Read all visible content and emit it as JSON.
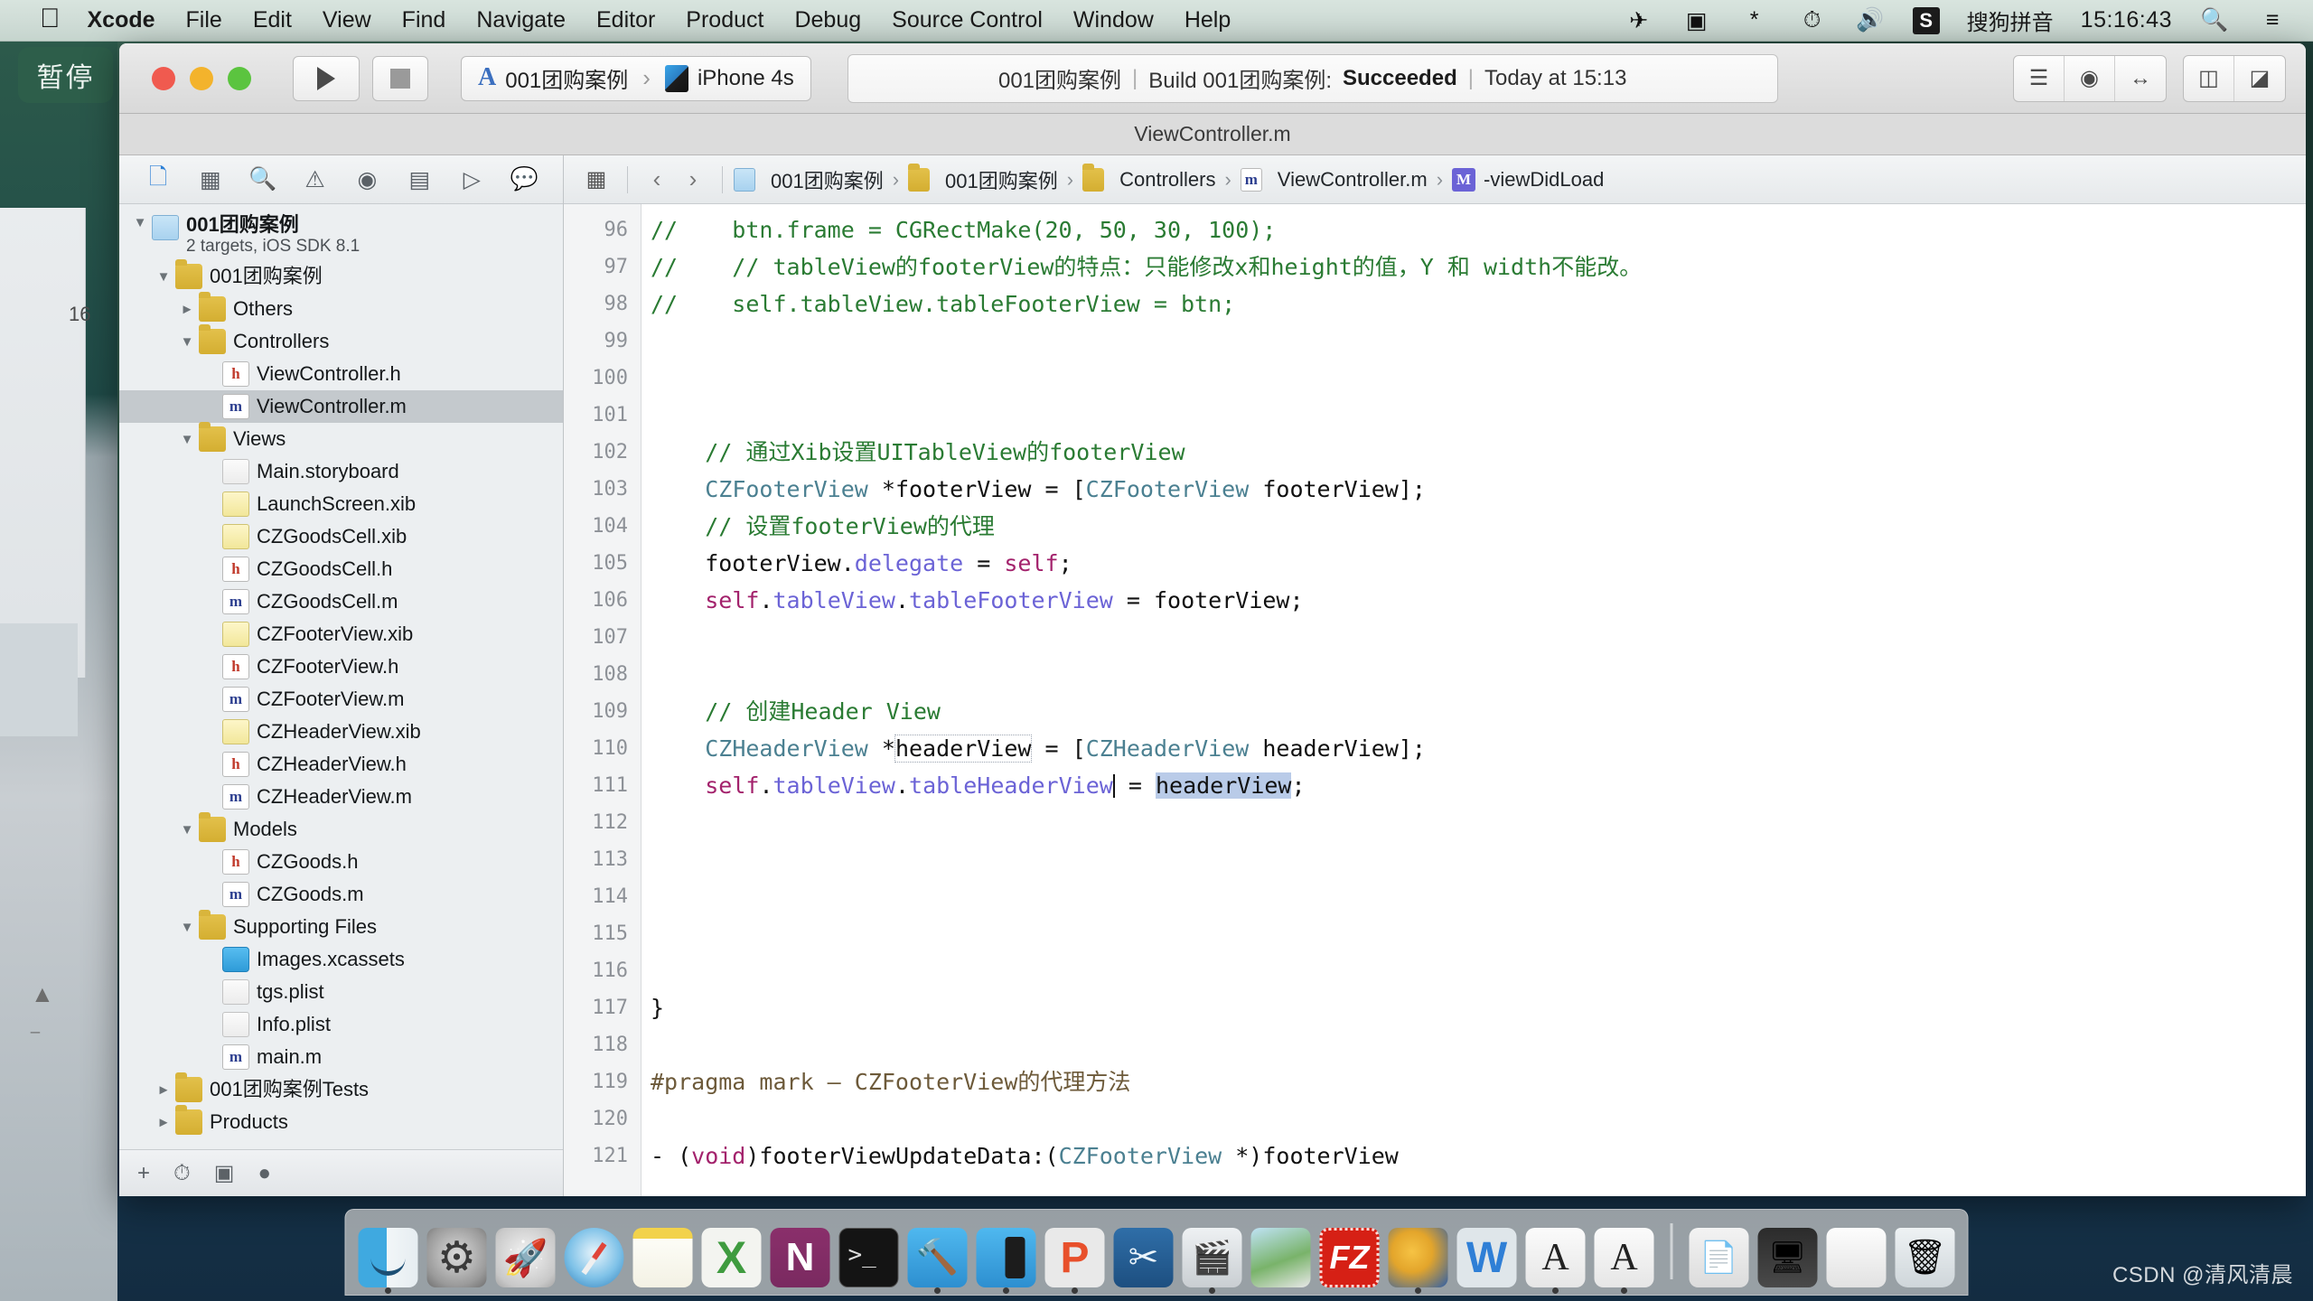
{
  "menubar": {
    "apple_icon": "apple-logo-icon",
    "items": [
      {
        "label": "Xcode",
        "bold": true
      },
      {
        "label": "File",
        "bold": false
      },
      {
        "label": "Edit",
        "bold": false
      },
      {
        "label": "View",
        "bold": false
      },
      {
        "label": "Find",
        "bold": false
      },
      {
        "label": "Navigate",
        "bold": false
      },
      {
        "label": "Editor",
        "bold": false
      },
      {
        "label": "Product",
        "bold": false
      },
      {
        "label": "Debug",
        "bold": false
      },
      {
        "label": "Source Control",
        "bold": false
      },
      {
        "label": "Window",
        "bold": false
      },
      {
        "label": "Help",
        "bold": false
      }
    ],
    "status": {
      "airplane_icon": "airplane-icon",
      "screenrecord_icon": "video-camera-icon",
      "bluetooth_icon": "bluetooth-icon",
      "timemachine_icon": "time-machine-clock-icon",
      "volume_icon": "speaker-volume-icon",
      "sogou_badge": "S",
      "ime_label": "搜狗拼音",
      "clock": "15:16:43",
      "search_icon": "spotlight-search-icon",
      "notification_icon": "notification-center-icon"
    }
  },
  "overlay": {
    "pause_badge": "暂停",
    "strip_number": "16",
    "eject_icon": "eject-icon"
  },
  "xcode": {
    "toolbar": {
      "run_icon": "play-run-icon",
      "stop_icon": "stop-square-icon",
      "scheme_app_icon": "xcode-scheme-icon",
      "scheme_name": "001团购案例",
      "scheme_separator": "›",
      "device_icon": "iphone-device-icon",
      "device_name": "iPhone 4s",
      "activity": {
        "project": "001团购案例",
        "sep1": "|",
        "build_prefix": "Build 001团购案例:",
        "build_status": "Succeeded",
        "sep2": "|",
        "build_time": "Today at 15:13"
      },
      "right_icons": [
        "standard-editor-icon",
        "assistant-editor-icon",
        "version-editor-icon",
        "hide-navigator-icon",
        "hide-utilities-icon"
      ]
    },
    "tabbar": {
      "active_tab": "ViewController.m"
    },
    "navigator": {
      "toolbar_icons": [
        "project-navigator-icon",
        "symbol-navigator-icon",
        "find-navigator-icon",
        "issue-navigator-icon",
        "test-navigator-icon",
        "debug-navigator-icon",
        "breakpoint-navigator-icon",
        "report-navigator-icon"
      ],
      "footer_icons": [
        "add-icon",
        "recent-filter-icon",
        "source-control-filter-icon",
        "filter-field-icon"
      ],
      "tree": [
        {
          "label": "001团购案例",
          "sub": "2 targets, iOS SDK 8.1",
          "icon": "proj",
          "indent": 0,
          "twisty": "down",
          "bold": true,
          "selected": false
        },
        {
          "label": "001团购案例",
          "sub": "",
          "icon": "folder",
          "indent": 1,
          "twisty": "down",
          "bold": false,
          "selected": false
        },
        {
          "label": "Others",
          "sub": "",
          "icon": "folder",
          "indent": 2,
          "twisty": "right",
          "bold": false,
          "selected": false
        },
        {
          "label": "Controllers",
          "sub": "",
          "icon": "folder",
          "indent": 2,
          "twisty": "down",
          "bold": false,
          "selected": false
        },
        {
          "label": "ViewController.h",
          "sub": "",
          "icon": "h",
          "indent": 3,
          "twisty": "none",
          "bold": false,
          "selected": false
        },
        {
          "label": "ViewController.m",
          "sub": "",
          "icon": "m",
          "indent": 3,
          "twisty": "none",
          "bold": false,
          "selected": true
        },
        {
          "label": "Views",
          "sub": "",
          "icon": "folder",
          "indent": 2,
          "twisty": "down",
          "bold": false,
          "selected": false
        },
        {
          "label": "Main.storyboard",
          "sub": "",
          "icon": "sb",
          "indent": 3,
          "twisty": "none",
          "bold": false,
          "selected": false
        },
        {
          "label": "LaunchScreen.xib",
          "sub": "",
          "icon": "xib",
          "indent": 3,
          "twisty": "none",
          "bold": false,
          "selected": false
        },
        {
          "label": "CZGoodsCell.xib",
          "sub": "",
          "icon": "xib",
          "indent": 3,
          "twisty": "none",
          "bold": false,
          "selected": false
        },
        {
          "label": "CZGoodsCell.h",
          "sub": "",
          "icon": "h",
          "indent": 3,
          "twisty": "none",
          "bold": false,
          "selected": false
        },
        {
          "label": "CZGoodsCell.m",
          "sub": "",
          "icon": "m",
          "indent": 3,
          "twisty": "none",
          "bold": false,
          "selected": false
        },
        {
          "label": "CZFooterView.xib",
          "sub": "",
          "icon": "xib",
          "indent": 3,
          "twisty": "none",
          "bold": false,
          "selected": false
        },
        {
          "label": "CZFooterView.h",
          "sub": "",
          "icon": "h",
          "indent": 3,
          "twisty": "none",
          "bold": false,
          "selected": false
        },
        {
          "label": "CZFooterView.m",
          "sub": "",
          "icon": "m",
          "indent": 3,
          "twisty": "none",
          "bold": false,
          "selected": false
        },
        {
          "label": "CZHeaderView.xib",
          "sub": "",
          "icon": "xib",
          "indent": 3,
          "twisty": "none",
          "bold": false,
          "selected": false
        },
        {
          "label": "CZHeaderView.h",
          "sub": "",
          "icon": "h",
          "indent": 3,
          "twisty": "none",
          "bold": false,
          "selected": false
        },
        {
          "label": "CZHeaderView.m",
          "sub": "",
          "icon": "m",
          "indent": 3,
          "twisty": "none",
          "bold": false,
          "selected": false
        },
        {
          "label": "Models",
          "sub": "",
          "icon": "folder",
          "indent": 2,
          "twisty": "down",
          "bold": false,
          "selected": false
        },
        {
          "label": "CZGoods.h",
          "sub": "",
          "icon": "h",
          "indent": 3,
          "twisty": "none",
          "bold": false,
          "selected": false
        },
        {
          "label": "CZGoods.m",
          "sub": "",
          "icon": "m",
          "indent": 3,
          "twisty": "none",
          "bold": false,
          "selected": false
        },
        {
          "label": "Supporting Files",
          "sub": "",
          "icon": "folder",
          "indent": 2,
          "twisty": "down",
          "bold": false,
          "selected": false
        },
        {
          "label": "Images.xcassets",
          "sub": "",
          "icon": "xcassets",
          "indent": 3,
          "twisty": "none",
          "bold": false,
          "selected": false
        },
        {
          "label": "tgs.plist",
          "sub": "",
          "icon": "plist",
          "indent": 3,
          "twisty": "none",
          "bold": false,
          "selected": false
        },
        {
          "label": "Info.plist",
          "sub": "",
          "icon": "plist",
          "indent": 3,
          "twisty": "none",
          "bold": false,
          "selected": false
        },
        {
          "label": "main.m",
          "sub": "",
          "icon": "m",
          "indent": 3,
          "twisty": "none",
          "bold": false,
          "selected": false
        },
        {
          "label": "001团购案例Tests",
          "sub": "",
          "icon": "folder",
          "indent": 1,
          "twisty": "right",
          "bold": false,
          "selected": false
        },
        {
          "label": "Products",
          "sub": "",
          "icon": "folder",
          "indent": 1,
          "twisty": "right",
          "bold": false,
          "selected": false
        }
      ]
    },
    "jumpbar": {
      "related_icon": "related-files-icon",
      "back_icon": "‹",
      "forward_icon": "›",
      "crumbs": [
        {
          "label": "001团购案例",
          "icon": "proj"
        },
        {
          "label": "001团购案例",
          "icon": "folder"
        },
        {
          "label": "Controllers",
          "icon": "folder"
        },
        {
          "label": "ViewController.m",
          "icon": "m"
        },
        {
          "label": "-viewDidLoad",
          "icon": "method"
        }
      ]
    },
    "editor": {
      "first_line_number": 96,
      "lines": [
        {
          "n": 96,
          "tokens": [
            {
              "t": "//    btn.frame = CGRectMake(20, 50, 30, 100);",
              "c": "cmt"
            }
          ]
        },
        {
          "n": 97,
          "tokens": [
            {
              "t": "//    // tableView的footerView的特点：只能修改x和height的值，Y 和 width不能改。",
              "c": "cmt"
            }
          ]
        },
        {
          "n": 98,
          "tokens": [
            {
              "t": "//    self.tableView.tableFooterView = btn;",
              "c": "cmt"
            }
          ]
        },
        {
          "n": 99,
          "tokens": []
        },
        {
          "n": 100,
          "tokens": []
        },
        {
          "n": 101,
          "tokens": []
        },
        {
          "n": 102,
          "tokens": [
            {
              "t": "    // 通过Xib设置UITableView的footerView",
              "c": "cmt"
            }
          ]
        },
        {
          "n": 103,
          "tokens": [
            {
              "t": "    ",
              "c": ""
            },
            {
              "t": "CZFooterView",
              "c": "typ"
            },
            {
              "t": " *footerView = [",
              "c": ""
            },
            {
              "t": "CZFooterView",
              "c": "typ"
            },
            {
              "t": " footerView];",
              "c": ""
            }
          ]
        },
        {
          "n": 104,
          "tokens": [
            {
              "t": "    // 设置footerView的代理",
              "c": "cmt"
            }
          ]
        },
        {
          "n": 105,
          "tokens": [
            {
              "t": "    footerView.",
              "c": ""
            },
            {
              "t": "delegate",
              "c": "prop"
            },
            {
              "t": " = ",
              "c": ""
            },
            {
              "t": "self",
              "c": "kw"
            },
            {
              "t": ";",
              "c": ""
            }
          ]
        },
        {
          "n": 106,
          "tokens": [
            {
              "t": "    ",
              "c": ""
            },
            {
              "t": "self",
              "c": "kw"
            },
            {
              "t": ".",
              "c": ""
            },
            {
              "t": "tableView",
              "c": "prop"
            },
            {
              "t": ".",
              "c": ""
            },
            {
              "t": "tableFooterView",
              "c": "prop"
            },
            {
              "t": " = footerView;",
              "c": ""
            }
          ]
        },
        {
          "n": 107,
          "tokens": []
        },
        {
          "n": 108,
          "tokens": []
        },
        {
          "n": 109,
          "tokens": [
            {
              "t": "    // 创建Header View",
              "c": "cmt"
            }
          ]
        },
        {
          "n": 110,
          "tokens": [
            {
              "t": "    ",
              "c": ""
            },
            {
              "t": "CZHeaderView",
              "c": "typ"
            },
            {
              "t": " *",
              "c": ""
            },
            {
              "t": "headerView",
              "c": "boxed"
            },
            {
              "t": " = [",
              "c": ""
            },
            {
              "t": "CZHeaderView",
              "c": "typ"
            },
            {
              "t": " headerView];",
              "c": ""
            }
          ]
        },
        {
          "n": 111,
          "tokens": [
            {
              "t": "    ",
              "c": ""
            },
            {
              "t": "self",
              "c": "kw"
            },
            {
              "t": ".",
              "c": ""
            },
            {
              "t": "tableView",
              "c": "prop"
            },
            {
              "t": ".",
              "c": ""
            },
            {
              "t": "tableHeaderView",
              "c": "prop"
            },
            {
              "t": "CARET",
              "c": "caret"
            },
            {
              "t": " = ",
              "c": ""
            },
            {
              "t": "headerView",
              "c": "sel-tok"
            },
            {
              "t": ";",
              "c": ""
            }
          ]
        },
        {
          "n": 112,
          "tokens": []
        },
        {
          "n": 113,
          "tokens": []
        },
        {
          "n": 114,
          "tokens": []
        },
        {
          "n": 115,
          "tokens": []
        },
        {
          "n": 116,
          "tokens": []
        },
        {
          "n": 117,
          "tokens": [
            {
              "t": "}",
              "c": ""
            }
          ]
        },
        {
          "n": 118,
          "tokens": []
        },
        {
          "n": 119,
          "tokens": [
            {
              "t": "#pragma mark ",
              "c": "pre"
            },
            {
              "t": "— CZFooterView的代理方法",
              "c": "pre"
            }
          ]
        },
        {
          "n": 120,
          "tokens": []
        },
        {
          "n": 121,
          "tokens": [
            {
              "t": "- (",
              "c": ""
            },
            {
              "t": "void",
              "c": "kw"
            },
            {
              "t": ")footerViewUpdateData:(",
              "c": ""
            },
            {
              "t": "CZFooterView",
              "c": "typ"
            },
            {
              "t": " *)footerView",
              "c": ""
            }
          ]
        }
      ]
    }
  },
  "dock": {
    "icons": [
      {
        "name": "finder",
        "cls": "d-finder",
        "running": true
      },
      {
        "name": "system-preferences",
        "cls": "d-prefs",
        "running": false
      },
      {
        "name": "launchpad",
        "cls": "d-launch",
        "running": false
      },
      {
        "name": "safari",
        "cls": "d-safari",
        "running": false
      },
      {
        "name": "notes",
        "cls": "d-notes",
        "running": false
      },
      {
        "name": "excel",
        "cls": "d-excel",
        "running": false
      },
      {
        "name": "onenote",
        "cls": "d-onenote",
        "running": false
      },
      {
        "name": "terminal",
        "cls": "d-term",
        "running": false
      },
      {
        "name": "xcode",
        "cls": "d-xcode",
        "running": true
      },
      {
        "name": "simulator",
        "cls": "d-sim",
        "running": true
      },
      {
        "name": "keynote",
        "cls": "d-keynote",
        "running": true
      },
      {
        "name": "snipaste",
        "cls": "d-snip",
        "running": false
      },
      {
        "name": "quicktime",
        "cls": "d-qt",
        "running": true
      },
      {
        "name": "photos",
        "cls": "d-photos",
        "running": false
      },
      {
        "name": "filezilla",
        "cls": "d-fz",
        "running": false
      },
      {
        "name": "paint-tool",
        "cls": "d-paint",
        "running": true
      },
      {
        "name": "word",
        "cls": "d-word",
        "running": false
      },
      {
        "name": "font-book-a",
        "cls": "d-font",
        "running": true
      },
      {
        "name": "font-book-b",
        "cls": "d-font",
        "running": true
      }
    ],
    "stacks": [
      {
        "name": "documents-stack",
        "cls": "d-stack"
      },
      {
        "name": "screens-stack",
        "cls": "d-screens"
      },
      {
        "name": "downloads-stack",
        "cls": "d-docs"
      },
      {
        "name": "trash",
        "cls": "d-trash"
      }
    ]
  },
  "watermark": "CSDN @清风清晨"
}
